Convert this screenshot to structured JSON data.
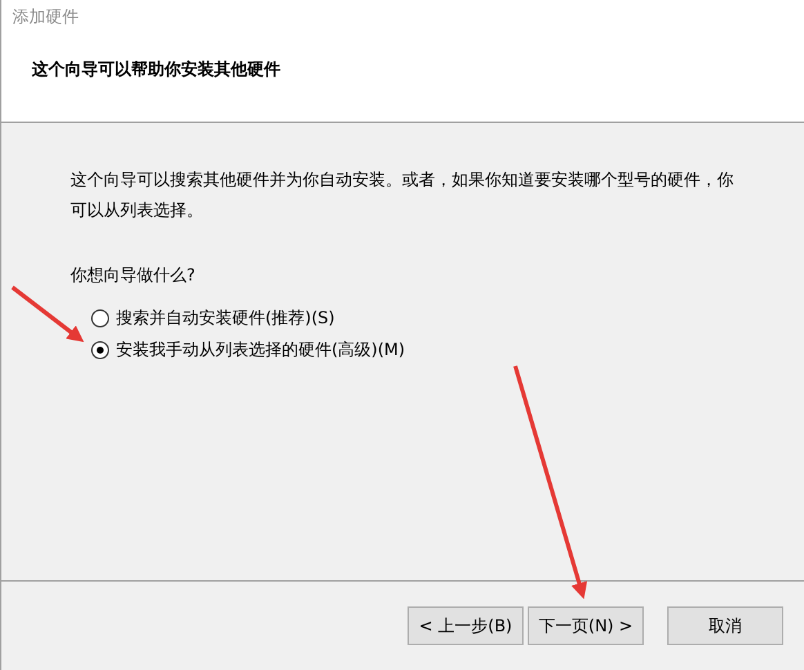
{
  "window": {
    "title": "添加硬件"
  },
  "header": {
    "heading": "这个向导可以帮助你安装其他硬件"
  },
  "body": {
    "description": "这个向导可以搜索其他硬件并为你自动安装。或者，如果你知道要安装哪个型号的硬件，你可以从列表选择。",
    "question": "你想向导做什么?",
    "options": [
      {
        "label": "搜索并自动安装硬件(推荐)(S)",
        "selected": false
      },
      {
        "label": "安装我手动从列表选择的硬件(高级)(M)",
        "selected": true
      }
    ]
  },
  "buttons": [
    {
      "label": "< 上一步(B)",
      "kind": "back"
    },
    {
      "label": "下一页(N) >",
      "kind": "next"
    },
    {
      "label": "取消",
      "kind": "cancel"
    }
  ]
}
